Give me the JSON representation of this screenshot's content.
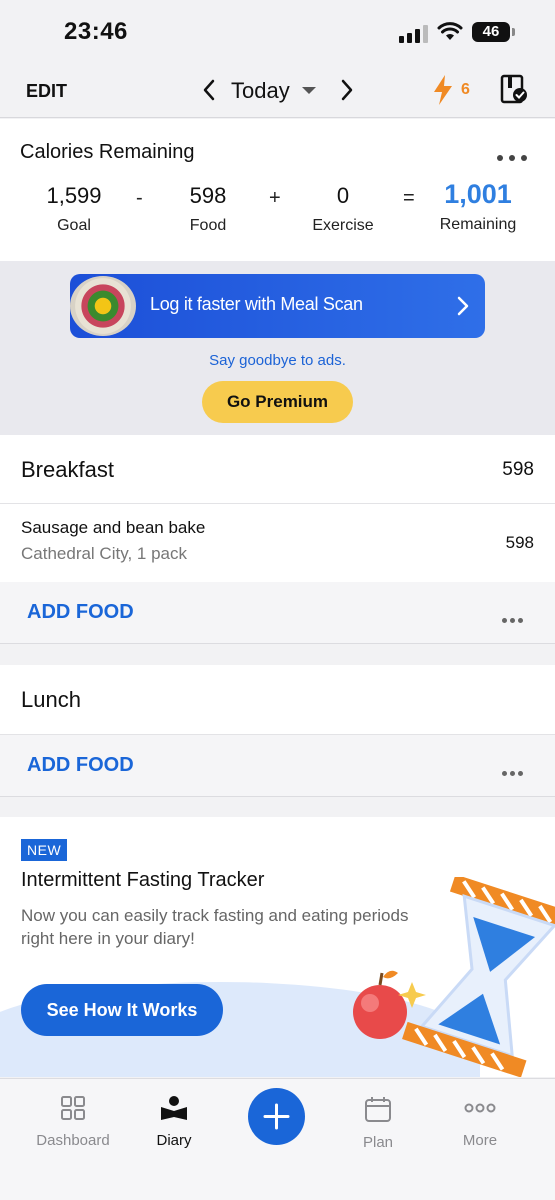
{
  "status_bar": {
    "time": "23:46",
    "battery": "46"
  },
  "top_nav": {
    "edit_label": "EDIT",
    "date_label": "Today",
    "streak_count": "6"
  },
  "calories": {
    "title": "Calories Remaining",
    "goal": {
      "value": "1,599",
      "label": "Goal"
    },
    "minus": "-",
    "food": {
      "value": "598",
      "label": "Food"
    },
    "plus": "+",
    "exercise": {
      "value": "0",
      "label": "Exercise"
    },
    "equals": "=",
    "remaining": {
      "value": "1,001",
      "label": "Remaining"
    }
  },
  "ad": {
    "meal_scan_label": "Log it faster with Meal Scan",
    "ads_text": "Say goodbye to ads.",
    "premium_label": "Go Premium"
  },
  "breakfast": {
    "title": "Breakfast",
    "calories": "598",
    "items": [
      {
        "name": "Sausage and bean bake",
        "detail": "Cathedral City, 1 pack",
        "calories": "598"
      }
    ],
    "add_label": "ADD FOOD"
  },
  "lunch": {
    "title": "Lunch",
    "add_label": "ADD FOOD"
  },
  "promo": {
    "badge": "NEW",
    "title": "Intermittent Fasting Tracker",
    "body": "Now you can easily track fasting and eating periods right here in your diary!",
    "button_label": "See How It Works"
  },
  "tab_bar": {
    "tabs": [
      {
        "label": "Dashboard",
        "icon": "dashboard-grid-icon"
      },
      {
        "label": "Diary",
        "icon": "diary-book-icon"
      },
      {
        "label": "",
        "icon": "plus-icon"
      },
      {
        "label": "Plan",
        "icon": "calendar-icon"
      },
      {
        "label": "More",
        "icon": "more-dots-icon"
      }
    ]
  },
  "colors": {
    "accent": "#1a66d8",
    "remaining": "#2f7fe0",
    "premium": "#f7cb4e",
    "streak": "#f08a24"
  }
}
